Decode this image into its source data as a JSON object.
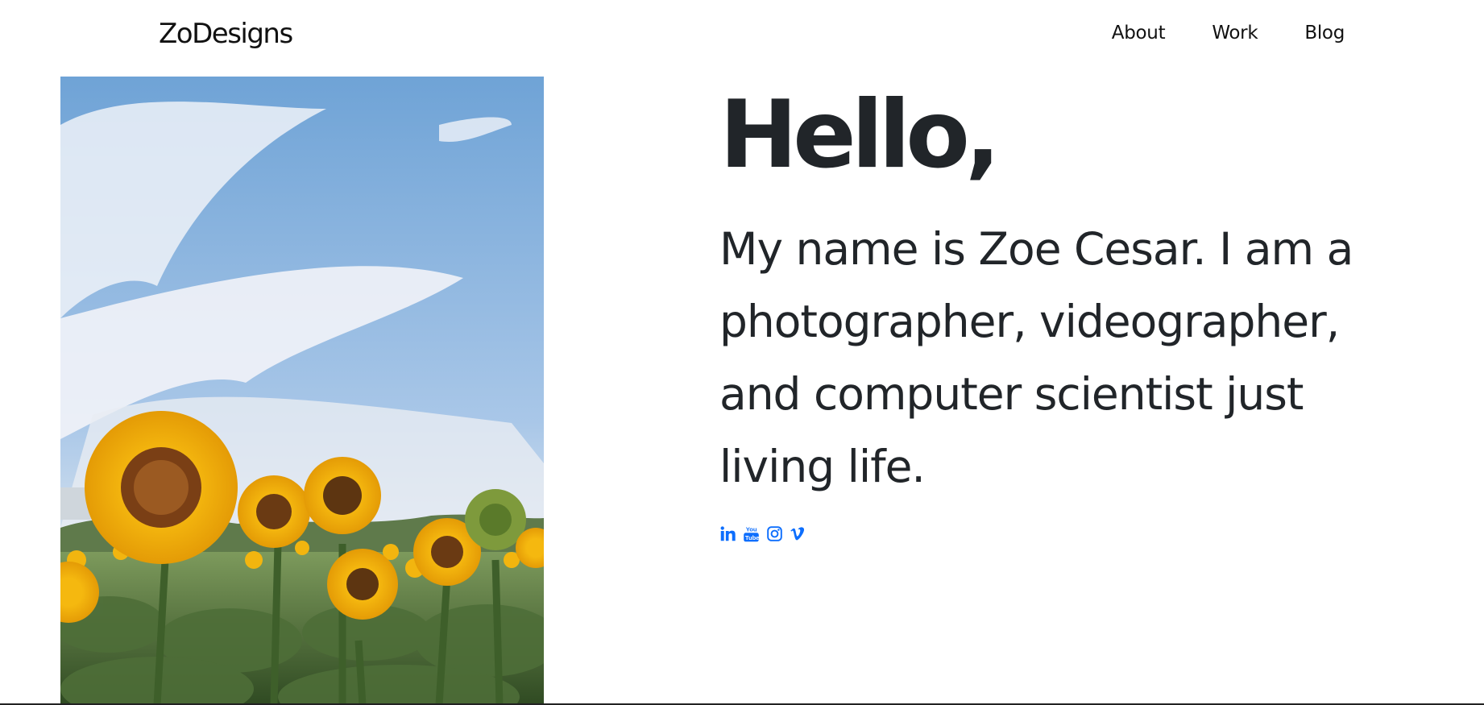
{
  "header": {
    "brand": "ZoDesigns",
    "nav": [
      {
        "label": "About"
      },
      {
        "label": "Work"
      },
      {
        "label": "Blog"
      }
    ]
  },
  "hero": {
    "heading": "Hello,",
    "intro": "My name is Zoe Cesar. I am a photographer, videographer, and computer scientist just living life."
  },
  "social": [
    {
      "icon": "linkedin-icon"
    },
    {
      "icon": "youtube-icon"
    },
    {
      "icon": "instagram-icon"
    },
    {
      "icon": "vimeo-icon"
    }
  ],
  "colors": {
    "text": "#212529",
    "accent": "#0d6efd",
    "background": "#ffffff"
  }
}
